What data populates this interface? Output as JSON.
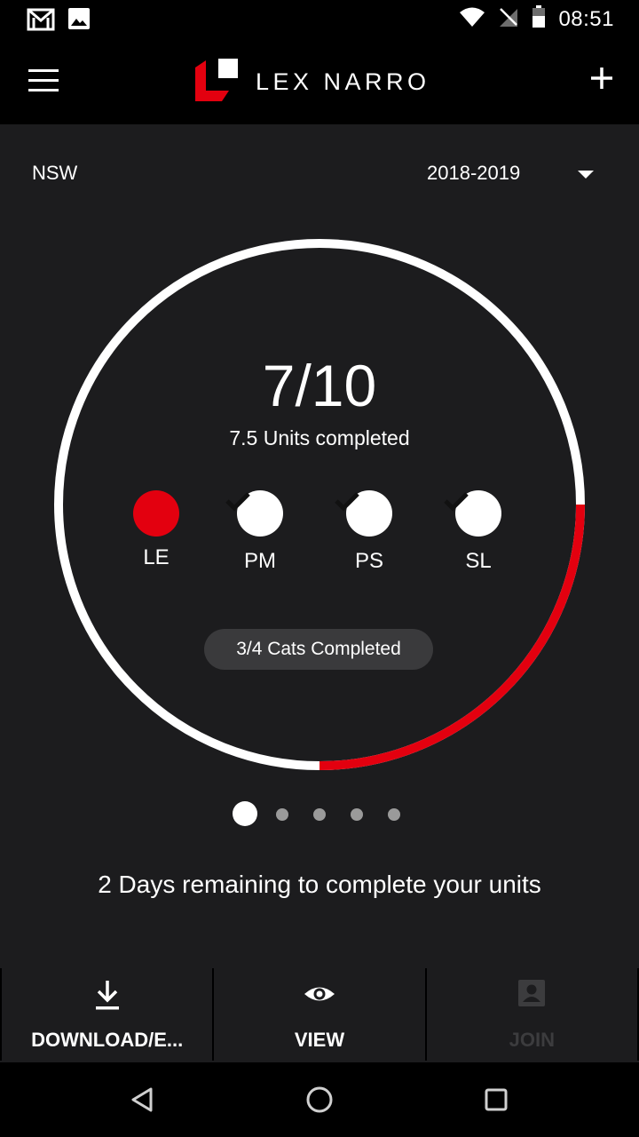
{
  "status_bar": {
    "time": "08:51",
    "left_icons": [
      "gmail-icon",
      "image-icon"
    ],
    "right_icons": [
      "wifi-icon",
      "no-signal-icon",
      "battery-icon"
    ]
  },
  "app_bar": {
    "brand_name": "LEX NARRO",
    "brand_color": "#e3000f",
    "menu_icon": "hamburger-menu-icon",
    "add_icon": "plus-icon"
  },
  "filters": {
    "state": "NSW",
    "year": "2018-2019"
  },
  "progress": {
    "score": "7/10",
    "units_completed_text": "7.5 Units completed",
    "completed_fraction": 0.25,
    "ring_color": "#ffffff",
    "progress_color": "#e3000f",
    "categories": [
      {
        "label": "LE",
        "status": "incomplete"
      },
      {
        "label": "PM",
        "status": "complete"
      },
      {
        "label": "PS",
        "status": "complete"
      },
      {
        "label": "SL",
        "status": "complete"
      }
    ],
    "cats_summary": "3/4 Cats Completed"
  },
  "pager": {
    "total": 5,
    "active": 0
  },
  "remaining_text": "2 Days remaining to complete your units",
  "actions": [
    {
      "label": "DOWNLOAD/E...",
      "icon": "download-icon",
      "enabled": true
    },
    {
      "label": "VIEW",
      "icon": "eye-icon",
      "enabled": true
    },
    {
      "label": "JOIN",
      "icon": "contact-card-icon",
      "enabled": false
    }
  ],
  "nav_bar": {
    "buttons": [
      "back-icon",
      "home-icon",
      "recents-icon"
    ]
  }
}
